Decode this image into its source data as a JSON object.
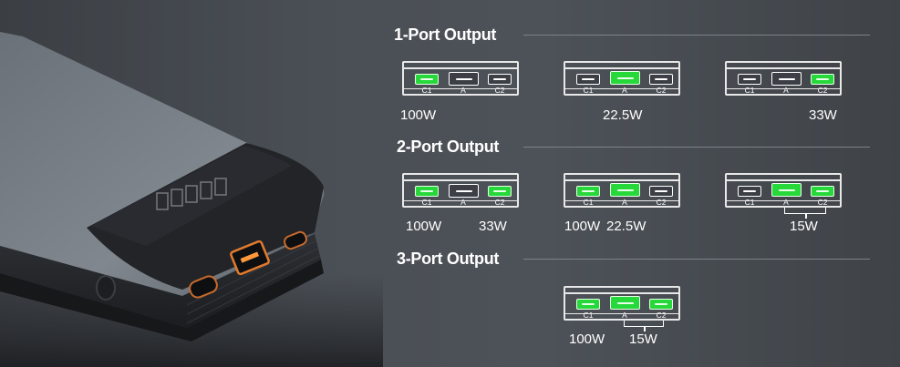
{
  "sections": [
    {
      "title": "1-Port Output"
    },
    {
      "title": "2-Port Output"
    },
    {
      "title": "3-Port Output"
    }
  ],
  "port_labels": {
    "c1": "C1",
    "a": "A",
    "c2": "C2"
  },
  "colors": {
    "active_port": "#27d83a",
    "background": "#45494f"
  },
  "configs": [
    {
      "section": "1-Port Output",
      "active": [
        "C1"
      ],
      "watts": [
        "100W"
      ]
    },
    {
      "section": "1-Port Output",
      "active": [
        "A"
      ],
      "watts": [
        "22.5W"
      ]
    },
    {
      "section": "1-Port Output",
      "active": [
        "C2"
      ],
      "watts": [
        "33W"
      ]
    },
    {
      "section": "2-Port Output",
      "active": [
        "C1",
        "C2"
      ],
      "watts": [
        "100W",
        "33W"
      ]
    },
    {
      "section": "2-Port Output",
      "active": [
        "C1",
        "A"
      ],
      "watts": [
        "100W",
        "22.5W"
      ]
    },
    {
      "section": "2-Port Output",
      "active": [
        "A",
        "C2"
      ],
      "watts": [
        "15W"
      ]
    },
    {
      "section": "3-Port Output",
      "active": [
        "C1",
        "A",
        "C2"
      ],
      "watts": [
        "100W",
        "15W"
      ]
    }
  ]
}
